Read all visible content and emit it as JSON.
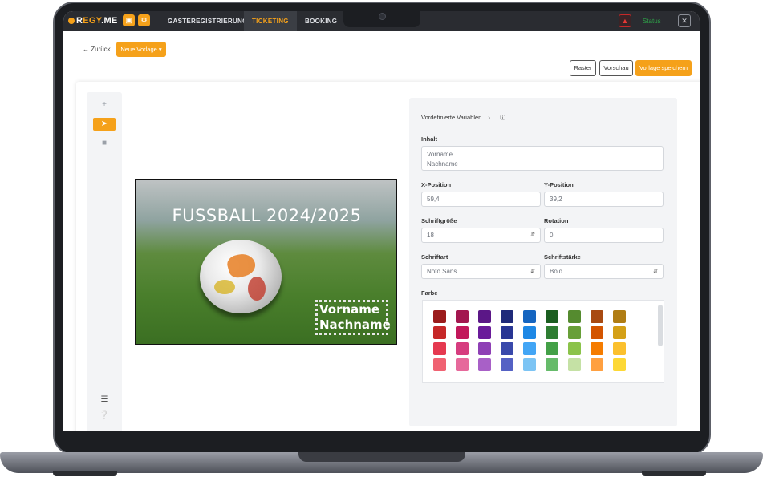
{
  "nav": {
    "logo_prefix": "R",
    "logo_mid": "EGY",
    "logo_suffix": ".ME",
    "links": [
      "GÄSTEREGISTRIERUNG",
      "TICKETING",
      "BOOKING"
    ],
    "status": "Status"
  },
  "header": {
    "back_label": "← Zurück",
    "new_template_label": "Neue Vorlage ▾",
    "grid_label": "Raster",
    "preview_label": "Vorschau",
    "save_label": "Vorlage speichern"
  },
  "ticket": {
    "title": "FUSSBALL 2024/2025",
    "name_line1": "Vorname",
    "name_line2": "Nachname"
  },
  "panel": {
    "variables_label": "Vordefinierte Variablen",
    "content_label": "Inhalt",
    "content_line1": "Vorname",
    "content_line2": "Nachname",
    "x_label": "X-Position",
    "x_value": "59,4",
    "y_label": "Y-Position",
    "y_value": "39,2",
    "size_label": "Schriftgröße",
    "size_value": "18",
    "rotation_label": "Rotation",
    "rotation_value": "0",
    "font_label": "Schriftart",
    "font_value": "Noto Sans",
    "weight_label": "Schriftstärke",
    "weight_value": "Bold",
    "color_label": "Farbe"
  },
  "colors": {
    "accent": "#f5a11a",
    "palette": [
      [
        "#9b1c1c",
        "#a3174f",
        "#5b1787",
        "#1f2a7a",
        "#1565c0",
        "#1b5e20",
        "#558b2f",
        "#a84a12",
        "#b07d14"
      ],
      [
        "#c62828",
        "#c2185b",
        "#6a1b9a",
        "#283593",
        "#1e88e5",
        "#2e7d32",
        "#689f38",
        "#d35400",
        "#d4a017"
      ],
      [
        "#e53950",
        "#d63d7f",
        "#8e3fb5",
        "#3949ab",
        "#42a5f5",
        "#43a047",
        "#8bc34a",
        "#f57c00",
        "#fbc02d"
      ],
      [
        "#f06272",
        "#e6699b",
        "#a860c7",
        "#5461c4",
        "#7cc4f4",
        "#66bb6a",
        "#c5e1a5",
        "#ffa040",
        "#fdd835"
      ]
    ]
  }
}
